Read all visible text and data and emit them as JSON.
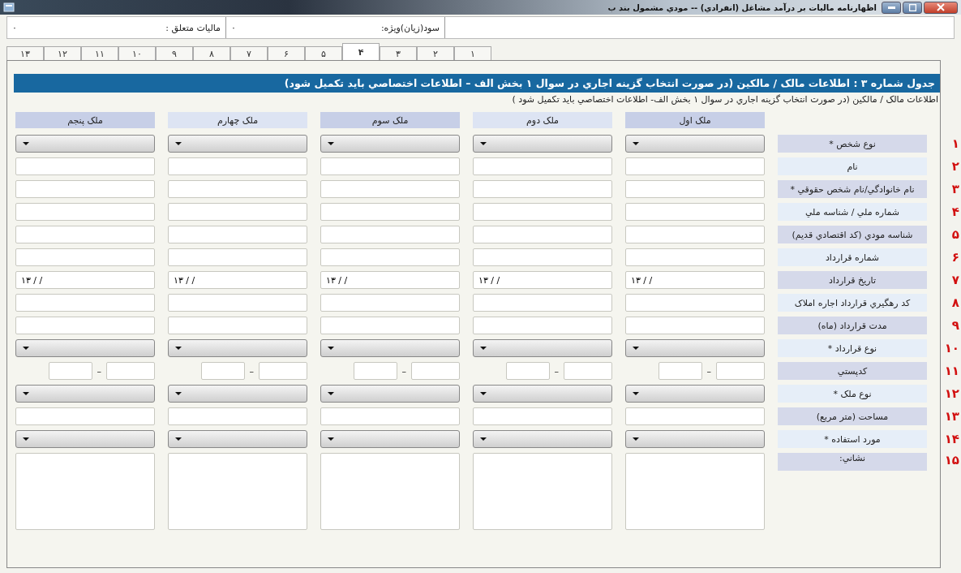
{
  "window": {
    "title": "اظهارنامه ماليات بر درآمد مشاغل (انفرادي) -- مودي مشمول بند ب"
  },
  "summary": [
    {
      "label": "سود(زيان)ويژه:",
      "value": "۰"
    },
    {
      "label": "ماليات متعلق :",
      "value": "۰"
    }
  ],
  "tabs": [
    {
      "label": "۱",
      "selected": false
    },
    {
      "label": "۲",
      "selected": false
    },
    {
      "label": "۳",
      "selected": false
    },
    {
      "label": "۴",
      "selected": true
    },
    {
      "label": "۵",
      "selected": false
    },
    {
      "label": "۶",
      "selected": false
    },
    {
      "label": "۷",
      "selected": false
    },
    {
      "label": "۸",
      "selected": false
    },
    {
      "label": "۹",
      "selected": false
    },
    {
      "label": "۱۰",
      "selected": false
    },
    {
      "label": "۱۱",
      "selected": false
    },
    {
      "label": "۱۲",
      "selected": false
    },
    {
      "label": "۱۳",
      "selected": false
    }
  ],
  "section": {
    "title": "جدول شماره ۳ : اطلاعات مالک / مالکين (در صورت انتخاب گزينه اجاري در سوال ۱ بخش الف – اطلاعات اختصاصي بايد تکميل شود)",
    "subtitle": "اطلاعات مالک / مالکين (در صورت انتخاب گزينه اجاري در سوال ۱ بخش الف- اطلاعات اختصاصي بايد تکميل شود )",
    "columns": [
      "ملک اول",
      "ملک دوم",
      "ملک سوم",
      "ملک چهارم",
      "ملک پنجم"
    ],
    "rows": [
      {
        "number": "۱",
        "label": "نوع شخص *",
        "kind": "select"
      },
      {
        "number": "۲",
        "label": "نام",
        "kind": "text"
      },
      {
        "number": "۳",
        "label": "نام خانوادگي/نام شخص حقوقي *",
        "kind": "text"
      },
      {
        "number": "۴",
        "label": "شماره ملي / شناسه ملي",
        "kind": "text"
      },
      {
        "number": "۵",
        "label": "شناسه مودي (کد اقتصادي قديم)",
        "kind": "text"
      },
      {
        "number": "۶",
        "label": "شماره قرارداد",
        "kind": "text"
      },
      {
        "number": "۷",
        "label": "تاريخ قرارداد",
        "kind": "date",
        "values": [
          "۱۳ / /",
          "۱۳ / /",
          "۱۳ / /",
          "۱۳ / /",
          "۱۳ / /"
        ]
      },
      {
        "number": "۸",
        "label": "کد رهگيري قرارداد اجاره املاک",
        "kind": "text"
      },
      {
        "number": "۹",
        "label": "مدت قرارداد (ماه)",
        "kind": "text"
      },
      {
        "number": "۱۰",
        "label": "نوع قرارداد *",
        "kind": "select"
      },
      {
        "number": "۱۱",
        "label": "کدپستي",
        "kind": "postal",
        "separators": [
          "–",
          "–",
          "–",
          "–",
          "–"
        ]
      },
      {
        "number": "۱۲",
        "label": "نوع ملک *",
        "kind": "select"
      },
      {
        "number": "۱۳",
        "label": "مساحت (متر مربع)",
        "kind": "text"
      },
      {
        "number": "۱۴",
        "label": "مورد استفاده *",
        "kind": "select"
      },
      {
        "number": "۱۵",
        "label": "نشاني:",
        "kind": "textarea"
      }
    ]
  }
}
